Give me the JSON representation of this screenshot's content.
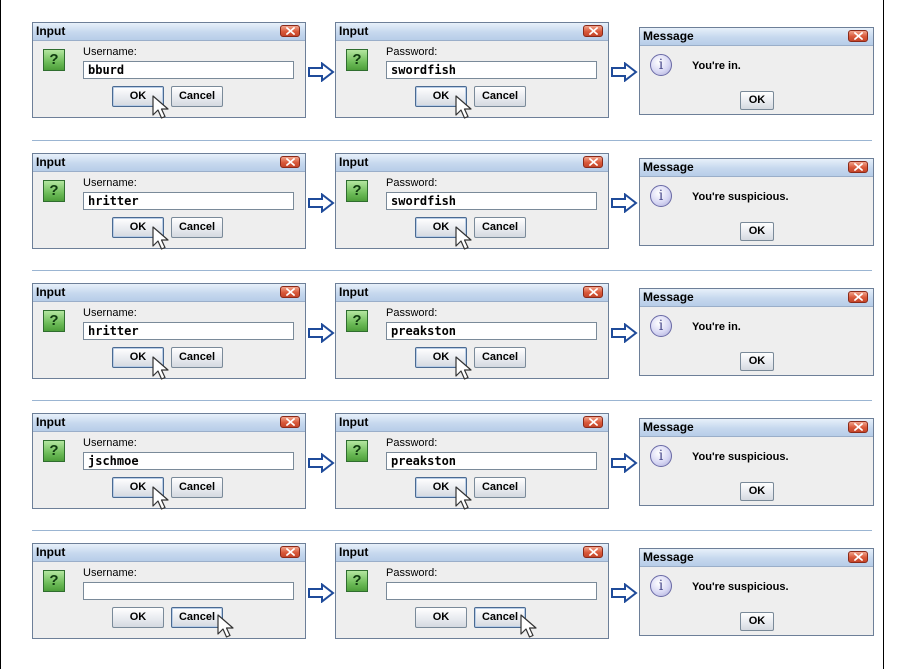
{
  "rows": [
    {
      "username": {
        "title": "Input",
        "prompt": "Username:",
        "value": "bburd",
        "ok": "OK",
        "cancel": "Cancel",
        "clicked": "ok"
      },
      "password": {
        "title": "Input",
        "prompt": "Password:",
        "value": "swordfish",
        "ok": "OK",
        "cancel": "Cancel",
        "clicked": "ok"
      },
      "message": {
        "title": "Message",
        "text": "You're in.",
        "ok": "OK"
      }
    },
    {
      "username": {
        "title": "Input",
        "prompt": "Username:",
        "value": "hritter",
        "ok": "OK",
        "cancel": "Cancel",
        "clicked": "ok"
      },
      "password": {
        "title": "Input",
        "prompt": "Password:",
        "value": "swordfish",
        "ok": "OK",
        "cancel": "Cancel",
        "clicked": "ok"
      },
      "message": {
        "title": "Message",
        "text": "You're suspicious.",
        "ok": "OK"
      }
    },
    {
      "username": {
        "title": "Input",
        "prompt": "Username:",
        "value": "hritter",
        "ok": "OK",
        "cancel": "Cancel",
        "clicked": "ok"
      },
      "password": {
        "title": "Input",
        "prompt": "Password:",
        "value": "preakston",
        "ok": "OK",
        "cancel": "Cancel",
        "clicked": "ok"
      },
      "message": {
        "title": "Message",
        "text": "You're in.",
        "ok": "OK"
      }
    },
    {
      "username": {
        "title": "Input",
        "prompt": "Username:",
        "value": "jschmoe",
        "ok": "OK",
        "cancel": "Cancel",
        "clicked": "ok"
      },
      "password": {
        "title": "Input",
        "prompt": "Password:",
        "value": "preakston",
        "ok": "OK",
        "cancel": "Cancel",
        "clicked": "ok"
      },
      "message": {
        "title": "Message",
        "text": "You're suspicious.",
        "ok": "OK"
      }
    },
    {
      "username": {
        "title": "Input",
        "prompt": "Username:",
        "value": "",
        "ok": "OK",
        "cancel": "Cancel",
        "clicked": "cancel"
      },
      "password": {
        "title": "Input",
        "prompt": "Password:",
        "value": "",
        "ok": "OK",
        "cancel": "Cancel",
        "clicked": "cancel"
      },
      "message": {
        "title": "Message",
        "text": "You're suspicious.",
        "ok": "OK"
      }
    }
  ],
  "icons": {
    "question": "question-icon",
    "info": "information-icon",
    "close": "close-icon",
    "arrow": "right-arrow-icon",
    "cursor": "mouse-pointer-icon"
  },
  "glyphs": {
    "question": "?",
    "info": "i"
  },
  "colors": {
    "titlebar_top": "#e7f0fa",
    "titlebar_bottom": "#b7cde8",
    "dialog_bg": "#eeeeee",
    "close_button": "#d9593a",
    "question_icon": "#6fbd5a",
    "info_icon": "#a9a9d6",
    "arrow": "#1f4b9a",
    "separator": "#9bb5d2"
  }
}
